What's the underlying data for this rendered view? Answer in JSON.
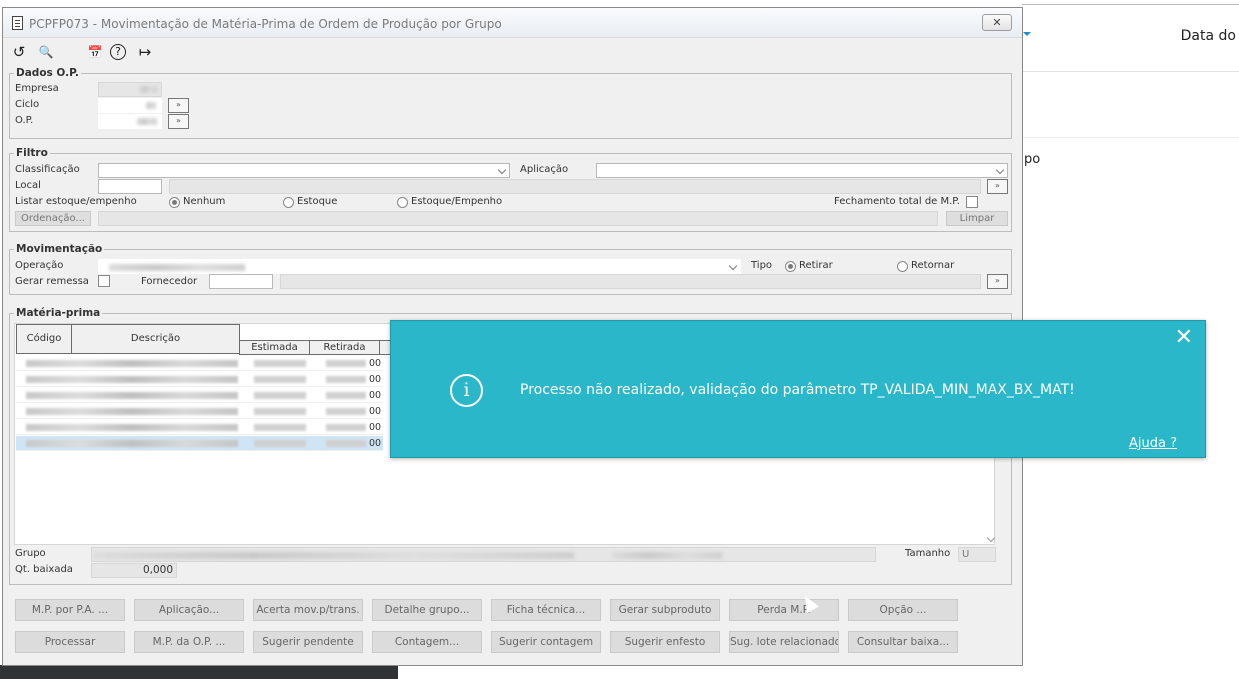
{
  "background": {
    "column_title": "Data do",
    "fragment": "po"
  },
  "window": {
    "title": "PCPFP073 - Movimentação de Matéria-Prima de Ordem de Produção por Grupo",
    "close": "✕"
  },
  "toolbar": {
    "undo": "↺",
    "search": "🔍",
    "calendar": "📅",
    "help": "?",
    "exit": "↦"
  },
  "dados_op": {
    "legend": "Dados O.P.",
    "empresa_label": "Empresa",
    "ciclo_label": "Ciclo",
    "op_label": "O.P."
  },
  "filtro": {
    "legend": "Filtro",
    "classificacao_label": "Classificação",
    "aplicacao_label": "Aplicação",
    "local_label": "Local",
    "listar_label": "Listar estoque/empenho",
    "radio_nenhum": "Nenhum",
    "radio_estoque": "Estoque",
    "radio_estoque_empenho": "Estoque/Empenho",
    "fechamento_label": "Fechamento total de M.P.",
    "ordenacao_button": "Ordenação...",
    "limpar_button": "Limpar"
  },
  "movimentacao": {
    "legend": "Movimentação",
    "operacao_label": "Operação",
    "tipo_label": "Tipo",
    "radio_retirar": "Retirar",
    "radio_retornar": "Retornar",
    "gerar_remessa_label": "Gerar remessa",
    "fornecedor_label": "Fornecedor"
  },
  "materia_prima": {
    "legend": "Matéria-prima",
    "headers": {
      "codigo": "Código",
      "descricao": "Descrição",
      "estimada": "Estimada",
      "retirada": "Retirada"
    },
    "rows": [
      {
        "suffix": "00"
      },
      {
        "suffix": "00"
      },
      {
        "suffix": "00"
      },
      {
        "suffix": "00"
      },
      {
        "suffix": "00"
      },
      {
        "suffix": "00"
      }
    ],
    "grupo_label": "Grupo",
    "tamanho_label": "Tamanho",
    "tamanho_value": "U",
    "qt_baixada_label": "Qt. baixada",
    "qt_baixada_value": "0,000"
  },
  "buttons_row1": [
    "M.P. por P.A. ...",
    "Aplicação...",
    "Acerta mov.p/trans.",
    "Detalhe grupo...",
    "Ficha técnica...",
    "Gerar subproduto",
    "Perda M.P.",
    "Opção ..."
  ],
  "buttons_row2": [
    "Processar",
    "M.P. da O.P. ...",
    "Sugerir pendente",
    "Contagem...",
    "Sugerir contagem",
    "Sugerir enfesto",
    "Sug. lote relacionado",
    "Consultar baixa..."
  ],
  "toast": {
    "icon": "i",
    "close": "✕",
    "message": "Processo não realizado, validação do parâmetro TP_VALIDA_MIN_MAX_BX_MAT!",
    "help_link": "Ajuda ?"
  }
}
